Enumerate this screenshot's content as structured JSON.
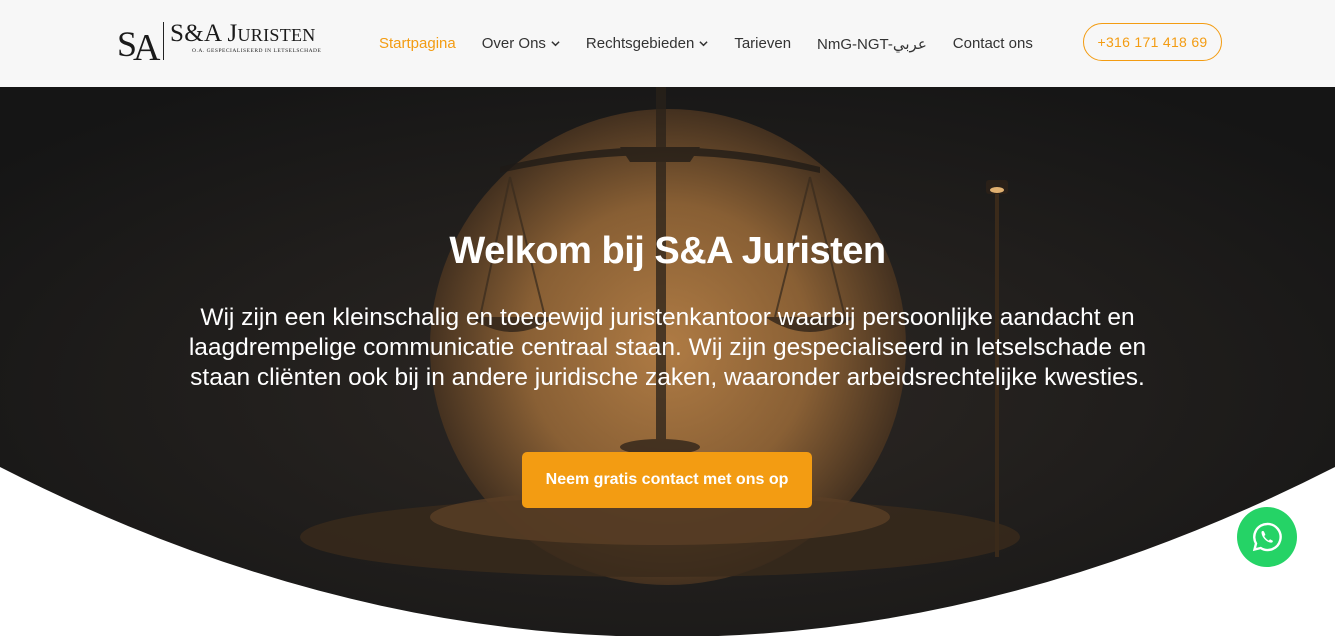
{
  "header": {
    "logo": {
      "mark": "SA",
      "name": "S&A Juristen",
      "tagline": "O.A. GESPECIALISEERD IN LETSELSCHADE"
    },
    "nav": [
      {
        "label": "Startpagina",
        "active": true,
        "has_dropdown": false
      },
      {
        "label": "Over Ons",
        "active": false,
        "has_dropdown": true
      },
      {
        "label": "Rechtsgebieden",
        "active": false,
        "has_dropdown": true
      },
      {
        "label": "Tarieven",
        "active": false,
        "has_dropdown": false
      },
      {
        "label": "NmG-NGT-عربي",
        "active": false,
        "has_dropdown": false
      },
      {
        "label": "Contact ons",
        "active": false,
        "has_dropdown": false
      }
    ],
    "phone": "+316 171 418 69"
  },
  "hero": {
    "title": "Welkom bij S&A Juristen",
    "text": "Wij zijn een kleinschalig en toegewijd juristenkantoor waarbij persoonlijke aandacht en laagdrempelige communicatie centraal staan. Wij zijn gespecialiseerd in letselschade en staan cliënten ook bij in andere juridische zaken, waaronder arbeidsrechtelijke kwesties.",
    "cta_label": "Neem gratis contact met ons op",
    "background_icon": "scales-of-justice"
  },
  "floating": {
    "whatsapp_icon": "whatsapp-icon"
  },
  "colors": {
    "accent": "#f39c12",
    "whatsapp": "#25d366",
    "header_bg": "#f7f7f7",
    "hero_dark": "#1f1f1f"
  }
}
